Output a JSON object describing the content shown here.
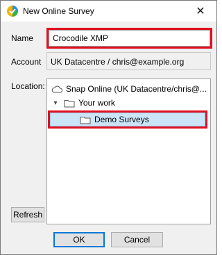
{
  "window": {
    "title": "New Online Survey",
    "app_icon": "snap-logo-icon",
    "close_glyph": "✕"
  },
  "form": {
    "name_label": "Name",
    "name_value": "Crocodile XMP",
    "account_label": "Account",
    "account_value": "UK Datacentre / chris@example.org",
    "location_label": "Location:"
  },
  "tree": {
    "items": [
      {
        "label": "Snap Online (UK Datacentre/chris@...",
        "icon": "cloud-icon"
      },
      {
        "label": "Your work",
        "icon": "folder-icon",
        "expanded": true
      },
      {
        "label": "Demo Surveys",
        "icon": "folder-icon",
        "selected": true
      }
    ]
  },
  "buttons": {
    "refresh": "Refresh",
    "ok": "OK",
    "cancel": "Cancel"
  },
  "colors": {
    "highlight": "#e0101e",
    "selection": "#cce4f7",
    "default_button_border": "#0078d7"
  }
}
